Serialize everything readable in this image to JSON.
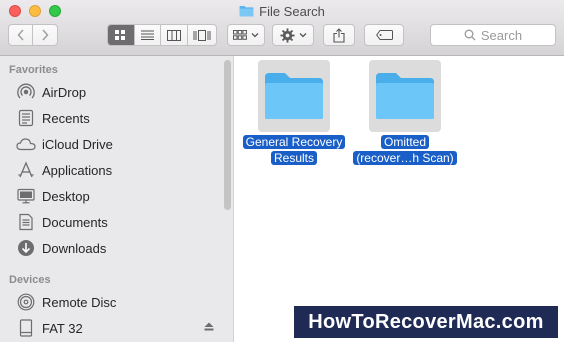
{
  "window": {
    "title": "File Search"
  },
  "toolbar": {
    "search_placeholder": "Search",
    "view_modes": [
      "icon-view",
      "list-view",
      "column-view",
      "cover-flow-view"
    ],
    "active_view": "icon-view"
  },
  "sidebar": {
    "favorites_header": "Favorites",
    "favorites": [
      {
        "label": "AirDrop",
        "icon": "airdrop-icon"
      },
      {
        "label": "Recents",
        "icon": "recents-icon"
      },
      {
        "label": "iCloud Drive",
        "icon": "icloud-icon"
      },
      {
        "label": "Applications",
        "icon": "applications-icon"
      },
      {
        "label": "Desktop",
        "icon": "desktop-icon"
      },
      {
        "label": "Documents",
        "icon": "documents-icon"
      },
      {
        "label": "Downloads",
        "icon": "downloads-icon"
      }
    ],
    "devices_header": "Devices",
    "devices": [
      {
        "label": "Remote Disc",
        "icon": "disc-icon"
      },
      {
        "label": "FAT 32",
        "icon": "drive-icon"
      }
    ]
  },
  "content": {
    "folders": [
      {
        "line1": "General Recovery",
        "line2": "Results"
      },
      {
        "line1": "Omitted",
        "line2": "(recover…h Scan)"
      }
    ]
  },
  "watermark": "HowToRecoverMac.com",
  "colors": {
    "selection": "#1a5fc8",
    "folder": "#5bc3f5",
    "watermark_bg": "#1f2a55"
  }
}
